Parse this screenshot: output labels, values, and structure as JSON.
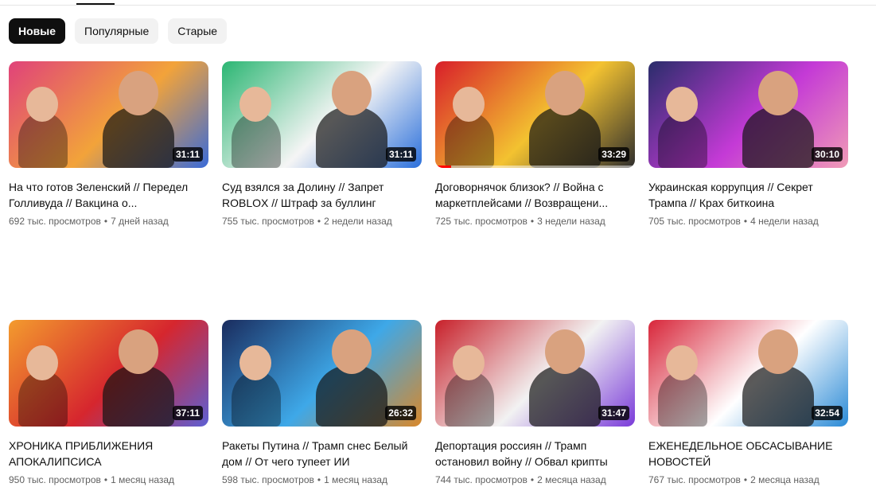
{
  "filters": [
    {
      "label": "Новые",
      "active": true
    },
    {
      "label": "Популярные",
      "active": false
    },
    {
      "label": "Старые",
      "active": false
    }
  ],
  "videos": [
    {
      "title": "На что готов Зеленский // Передел Голливуда // Вакцина о...",
      "views": "692 тыс. просмотров",
      "age": "7 дней назад",
      "duration": "31:11",
      "palette": [
        "#e0427a",
        "#f2a33a",
        "#3a6bd8"
      ]
    },
    {
      "title": "Суд взялся за Долину // Запрет ROBLOX // Штраф за буллинг",
      "views": "755 тыс. просмотров",
      "age": "2 недели назад",
      "duration": "31:11",
      "palette": [
        "#2bb673",
        "#f5f5f5",
        "#2a6fdb"
      ]
    },
    {
      "title": "Договорнячок близок? // Война с маркетплейсами // Возвращени...",
      "views": "725 тыс. просмотров",
      "age": "3 недели назад",
      "duration": "33:29",
      "palette": [
        "#d81e2a",
        "#f3c230",
        "#2e2e2e"
      ],
      "progress": 0.08
    },
    {
      "title": "Украинская коррупция // Секрет Трампа // Крах биткоина",
      "views": "705 тыс. просмотров",
      "age": "4 недели назад",
      "duration": "30:10",
      "palette": [
        "#2a2d6b",
        "#c43ad6",
        "#f09bb6"
      ]
    },
    {
      "title": "ХРОНИКА ПРИБЛИЖЕНИЯ АПОКАЛИПСИСА",
      "views": "950 тыс. просмотров",
      "age": "1 месяц назад",
      "duration": "37:11",
      "palette": [
        "#f39b2e",
        "#d6262e",
        "#5d5fd3"
      ]
    },
    {
      "title": "Ракеты Путина // Трамп снес Белый дом // От чего тупеет ИИ",
      "views": "598 тыс. просмотров",
      "age": "1 месяц назад",
      "duration": "26:32",
      "palette": [
        "#1a2c5e",
        "#3ea8e8",
        "#d9882a"
      ]
    },
    {
      "title": "Депортация россиян // Трамп остановил войну // Обвал крипты",
      "views": "744 тыс. просмотров",
      "age": "2 месяца назад",
      "duration": "31:47",
      "palette": [
        "#c8202a",
        "#f2f2f2",
        "#7a3bd9"
      ]
    },
    {
      "title": "ЕЖЕНЕДЕЛЬНОЕ ОБСАСЫВАНИЕ НОВОСТЕЙ",
      "views": "767 тыс. просмотров",
      "age": "2 месяца назад",
      "duration": "32:54",
      "palette": [
        "#d8263a",
        "#ffffff",
        "#2a8ad6"
      ]
    }
  ]
}
